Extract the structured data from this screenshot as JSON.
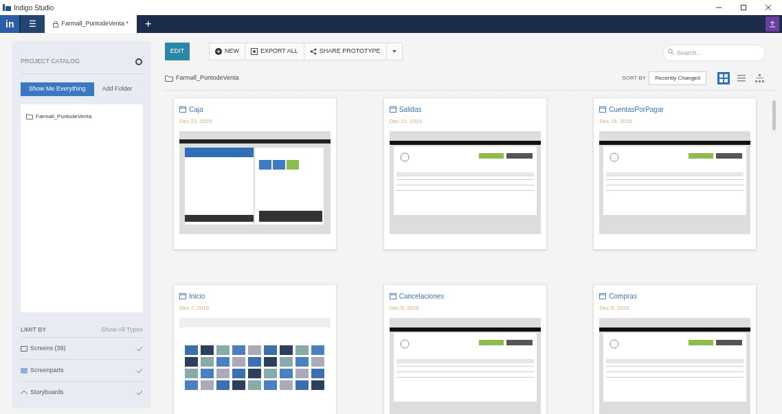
{
  "window": {
    "title": "Indigo Studio"
  },
  "nav": {
    "logo": "in",
    "menu": "☰",
    "tabs": [
      {
        "label": "Farmall_PuntodeVenta *",
        "selected": true
      }
    ],
    "add": "+"
  },
  "sidebar": {
    "title": "PROJECT CATALOG",
    "show_all": "Show Me Everything",
    "add_folder": "Add Folder",
    "folders": [
      {
        "label": "Farmall_PuntodeVenta",
        "selected": false
      }
    ],
    "limit_by": "LIMIT BY",
    "show_all_types": "Show All Types",
    "types": [
      {
        "kind": "screen",
        "label": "Screens (39)",
        "checked": true
      },
      {
        "kind": "screenpart",
        "label": "Screenparts",
        "checked": true
      },
      {
        "kind": "storyboard",
        "label": "Storyboards",
        "checked": true
      }
    ]
  },
  "toolbar": {
    "edit": "EDIT",
    "new": "NEW",
    "export": "EXPORT ALL",
    "share": "SHARE PROTOTYPE",
    "search": {
      "placeholder": "Search..."
    }
  },
  "breadcrumb": "Farmall_PuntodeVenta",
  "sort": {
    "label": "SORT BY",
    "value": "Recently Changed"
  },
  "views": [
    {
      "kind": "tiles",
      "selected": true
    },
    {
      "kind": "list",
      "selected": false
    },
    {
      "kind": "tree",
      "selected": false
    }
  ],
  "cards": [
    {
      "kind": "pos",
      "title": "Caja",
      "date": "Dec 21, 2015"
    },
    {
      "kind": "list",
      "title": "Salidas",
      "date": "Dec 21, 2015"
    },
    {
      "kind": "list",
      "title": "CuentasPorPagar",
      "date": "Dec 15, 2015"
    },
    {
      "kind": "grid",
      "title": "Inicio",
      "date": "Dec 7, 2015"
    },
    {
      "kind": "list",
      "title": "Cancelaciones",
      "date": "Dec 5, 2015"
    },
    {
      "kind": "list",
      "title": "Compras",
      "date": "Dec 5, 2015"
    }
  ]
}
